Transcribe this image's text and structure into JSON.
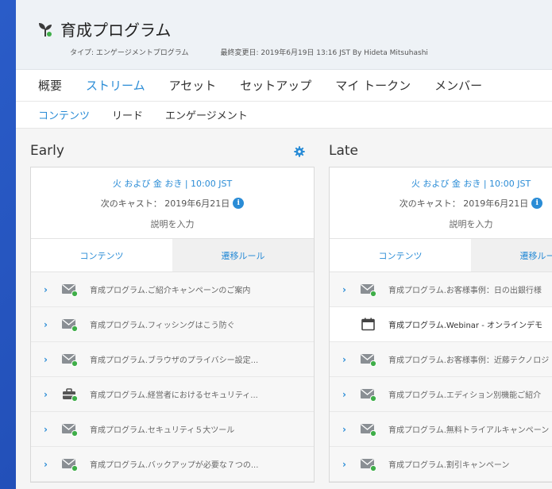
{
  "header": {
    "title": "育成プログラム",
    "type_text": "タイプ: エンゲージメントプログラム",
    "updated_text": "最終変更日: 2019年6月19日 13:16 JST By Hideta Mitsuhashi"
  },
  "main_tabs": [
    "概要",
    "ストリーム",
    "アセット",
    "セットアップ",
    "マイ トークン",
    "メンバー"
  ],
  "main_tab_active": 1,
  "sub_tabs": [
    "コンテンツ",
    "リード",
    "エンゲージメント"
  ],
  "sub_tab_active": 0,
  "colors": {
    "accent": "#2a8cd6",
    "green": "#3fae49",
    "bg_blue": "#1f4fb8"
  },
  "streams": [
    {
      "title": "Early",
      "schedule": "火 および 金 おき | 10:00 JST",
      "next_cast": "次のキャスト： 2019年6月21日",
      "description": "説明を入力",
      "tab_content": "コンテンツ",
      "tab_rules": "遷移ルール",
      "items": [
        {
          "icon": "email-icon",
          "label": "育成プログラム.ご紹介キャンペーンのご案内",
          "expandable": true
        },
        {
          "icon": "email-icon",
          "label": "育成プログラム.フィッシングはこう防ぐ",
          "expandable": true
        },
        {
          "icon": "email-icon",
          "label": "育成プログラム.ブラウザのプライバシー設定...",
          "expandable": true
        },
        {
          "icon": "program-icon",
          "label": "育成プログラム.経営者におけるセキュリティ...",
          "expandable": true
        },
        {
          "icon": "email-icon",
          "label": "育成プログラム.セキュリティ５大ツール",
          "expandable": true
        },
        {
          "icon": "email-icon",
          "label": "育成プログラム.バックアップが必要な７つの...",
          "expandable": true
        }
      ]
    },
    {
      "title": "Late",
      "schedule": "火 および 金 おき | 10:00 JST",
      "next_cast": "次のキャスト： 2019年6月21日",
      "description": "説明を入力",
      "tab_content": "コンテンツ",
      "tab_rules": "遷移ルール",
      "items": [
        {
          "icon": "email-icon",
          "label": "育成プログラム.お客様事例：日の出銀行様",
          "expandable": true
        },
        {
          "icon": "calendar-icon",
          "label": "育成プログラム.Webinar - オンラインデモ",
          "expandable": false
        },
        {
          "icon": "email-icon",
          "label": "育成プログラム.お客様事例：近藤テクノロジ",
          "expandable": true
        },
        {
          "icon": "email-icon",
          "label": "育成プログラム.エディション別機能ご紹介",
          "expandable": true
        },
        {
          "icon": "email-icon",
          "label": "育成プログラム.無料トライアルキャンペーン",
          "expandable": true
        },
        {
          "icon": "email-icon",
          "label": "育成プログラム.割引キャンペーン",
          "expandable": true
        }
      ]
    }
  ]
}
